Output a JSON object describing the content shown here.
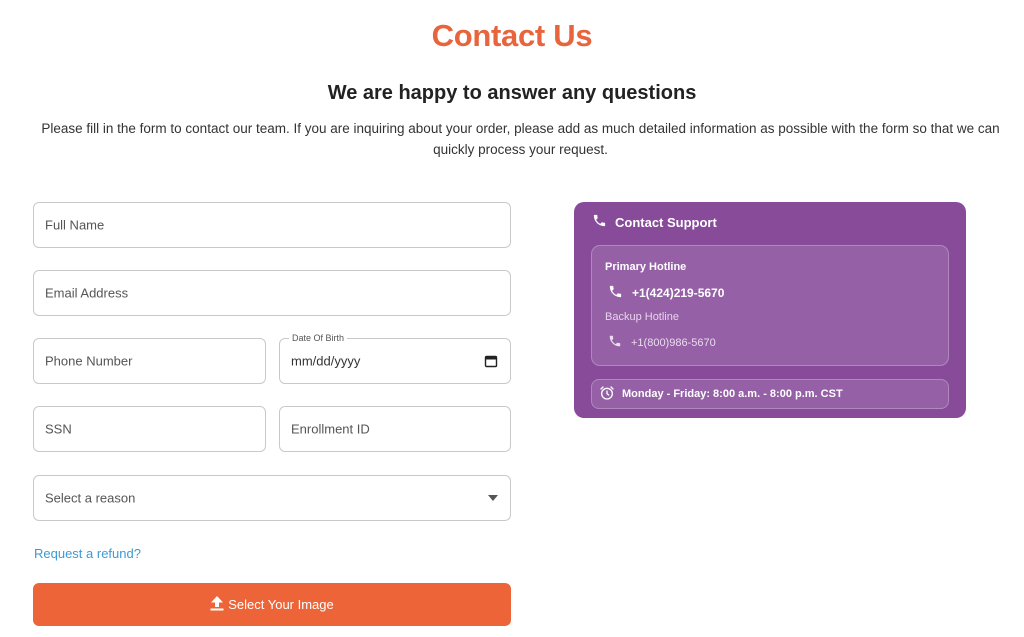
{
  "header": {
    "title": "Contact Us",
    "subtitle": "We are happy to answer any questions",
    "intro": "Please fill in the form to contact our team. If you are inquiring about your order, please add as much detailed information as possible with the form so that we can quickly process your request."
  },
  "form": {
    "full_name_placeholder": "Full Name",
    "email_placeholder": "Email Address",
    "phone_placeholder": "Phone Number",
    "dob_label": "Date Of Birth",
    "dob_placeholder": "mm/dd/yyyy",
    "ssn_placeholder": "SSN",
    "enrollment_placeholder": "Enrollment ID",
    "reason_selected": "Select a reason",
    "refund_link": "Request a refund?",
    "upload_label": "Select Your Image"
  },
  "support": {
    "heading": "Contact Support",
    "primary_label": "Primary Hotline",
    "primary_number": "+1(424)219-5670",
    "backup_label": "Backup Hotline",
    "backup_number": "+1(800)986-5670",
    "hours": "Monday - Friday: 8:00 a.m. - 8:00 p.m. CST",
    "bg_color": "#874b9a",
    "icons": [
      "phone-icon",
      "alarm-clock-icon"
    ]
  },
  "colors": {
    "accent": "#e8643c",
    "button": "#ec6437",
    "link": "#3c9ad6"
  }
}
